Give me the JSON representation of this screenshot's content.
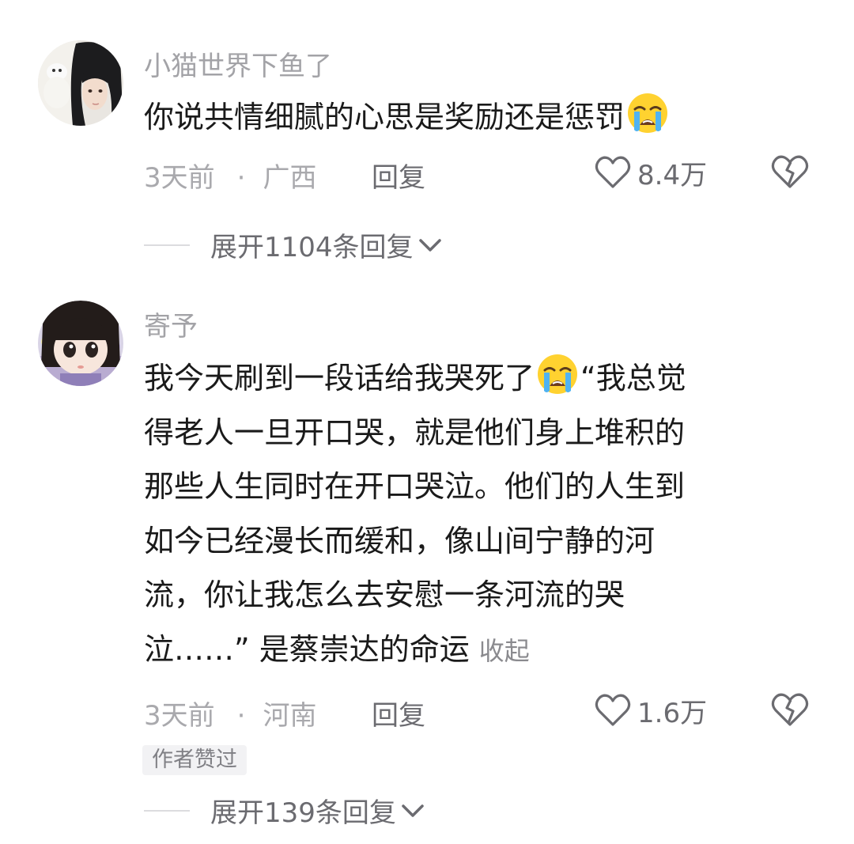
{
  "comments": [
    {
      "username": "小猫世界下鱼了",
      "text_before_emoji": "你说共情细腻的心思是奖励还是惩罚",
      "emoji": "loudly-crying-face",
      "time": "3天前",
      "separator": "·",
      "location": "广西",
      "reply_label": "回复",
      "likes": "8.4万",
      "expand_label": "展开1104条回复"
    },
    {
      "username": "寄予",
      "line1_a": "我今天刷到一段话给我哭死了",
      "emoji": "loudly-crying-face",
      "line1_b": "“我总觉",
      "line2": "得老人一旦开口哭，就是他们身上堆积的",
      "line3": "那些人生同时在开口哭泣。他们的人生到",
      "line4": "如今已经漫长而缓和，像山间宁静的河",
      "line5": "流，你让我怎么去安慰一条河流的哭",
      "line6": "泣……” 是蔡崇达的命运",
      "collapse_label": "收起",
      "time": "3天前",
      "separator": "·",
      "location": "河南",
      "reply_label": "回复",
      "likes": "1.6万",
      "author_badge": "作者赞过",
      "expand_label": "展开139条回复"
    }
  ],
  "icons": {
    "like": "heart-outline-icon",
    "dislike": "broken-heart-icon",
    "expand": "chevron-down-icon"
  },
  "colors": {
    "primary_text": "#1a1a1a",
    "secondary_text": "#a9a9ad",
    "action_text": "#6b6b70",
    "badge_bg": "#f2f2f4"
  }
}
